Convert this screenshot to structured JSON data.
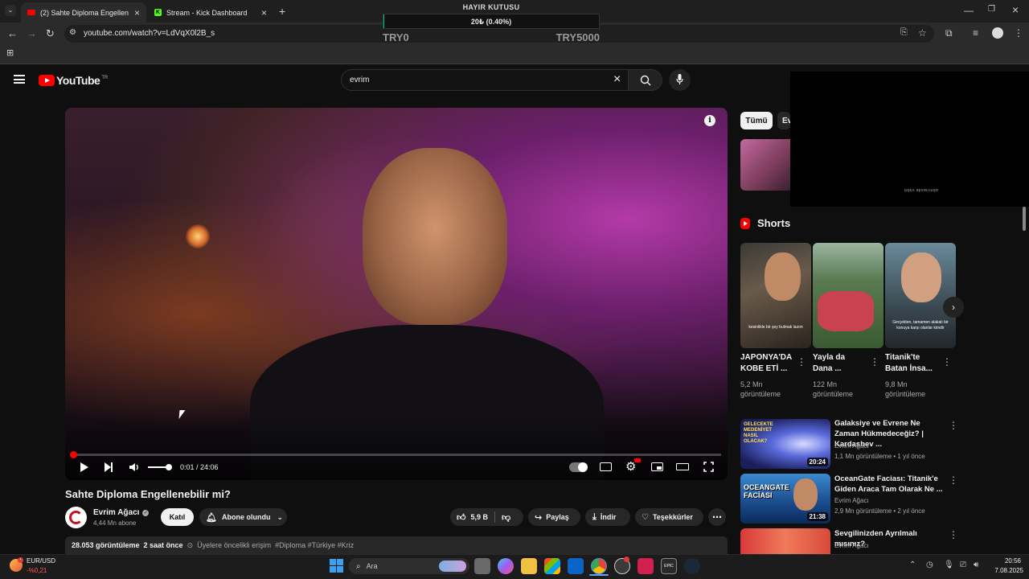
{
  "browser": {
    "tabs": [
      {
        "title": "(2) Sahte Diploma Engellenebilir",
        "active": true
      },
      {
        "title": "Stream - Kick Dashboard",
        "active": false
      }
    ],
    "url": "youtube.com/watch?v=LdVqX0l2B_s"
  },
  "donation": {
    "title": "HAYIR KUTUSU",
    "progress_text": "20₺ (0.40%)",
    "progress_fraction": 0.004,
    "min_label": "TRY0",
    "max_label": "TRY5000"
  },
  "youtube": {
    "logo_text": "YouTube",
    "region": "TR",
    "search_value": "evrim",
    "player": {
      "time": "0:01 / 24:06",
      "progress_fraction": 0.001,
      "volume_fraction": 0.85
    },
    "video": {
      "title": "Sahte Diploma Engellenebilir mi?",
      "channel": "Evrim Ağacı",
      "subscribers": "4,44 Mn abone",
      "join_label": "Katıl",
      "subscribed_label": "Abone olundu",
      "likes": "5,9 B",
      "share_label": "Paylaş",
      "download_label": "İndir",
      "thanks_label": "Teşekkürler",
      "views": "28.053 görüntüleme",
      "published": "2 saat önce",
      "members_label": "Üyelere öncelikli erişim",
      "hashtags": "#Diploma #Türkiye #Kriz"
    },
    "chips": [
      "Tümü",
      "Ev"
    ],
    "shorts_header": "Shorts",
    "shorts": [
      {
        "title": "JAPONYA'DA KOBE ETİ ...",
        "views": "5,2 Mn",
        "views_label": "görüntüleme",
        "caption": "kesinlikle bir şey bulmak lazım"
      },
      {
        "title": "Yayla da Dana ...",
        "views": "122 Mn",
        "views_label": "görüntüleme",
        "caption": ""
      },
      {
        "title": "Titanik'te Batan İnsa...",
        "views": "9,8 Mn",
        "views_label": "görüntüleme",
        "caption": "Gerçekten, tamamen alakalı bir konuya karşı olanlar kimdir"
      }
    ],
    "recommended": [
      {
        "title": "Galaksiye ve Evrene Ne Zaman Hükmedeceğiz? | Kardashev ...",
        "channel": "Evrim Ağacı",
        "meta": "1,1 Mn görüntüleme • 1 yıl önce",
        "duration": "20:24",
        "thumb_text": "GELECEKTE MEDENİYET NASIL OLACAK?"
      },
      {
        "title": "OceanGate Faciası: Titanik'e Giden Araca Tam Olarak Ne ...",
        "channel": "Evrim Ağacı",
        "meta": "2,9 Mn görüntüleme • 2 yıl önce",
        "duration": "21:38",
        "thumb_text": "OCEANGATE FACİASI"
      },
      {
        "title": "Sevgilinizden Ayrılmalı mısınız?",
        "channel": "Evrim Ağacı",
        "meta": "",
        "duration": "",
        "thumb_text": ""
      }
    ],
    "overlay_text": "ödev aksanında"
  },
  "taskbar": {
    "ticker_name": "EUR/USD",
    "ticker_change": "-%0,21",
    "search_label": "Ara",
    "time": "20:56",
    "date": "7.08.2025"
  },
  "colors": {
    "yt_red": "#ff0000",
    "bg": "#0f0f0f",
    "accent_teal": "#00c48c",
    "ticker_negative": "#ff5b5b"
  }
}
